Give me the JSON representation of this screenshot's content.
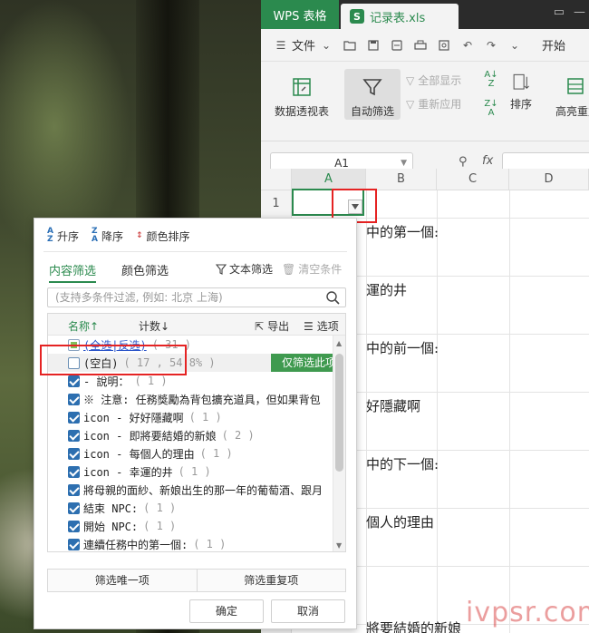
{
  "app": {
    "tab_app": "WPS 表格",
    "tab_doc": "记录表.xls",
    "tab_doc_icon": "S"
  },
  "menubar": {
    "file_label": "文件",
    "start_label": "开始"
  },
  "ribbon": {
    "pivot_label": "数据透视表",
    "autofilter_label": "自动筛选",
    "show_all_label": "全部显示",
    "reapply_label": "重新应用",
    "sort_label": "排序",
    "highlight_label": "高亮重复"
  },
  "formula": {
    "namebox": "A1",
    "fx": "fx"
  },
  "grid": {
    "columns": [
      "A",
      "B",
      "C",
      "D"
    ],
    "row1": "1",
    "cell_texts": [
      "中的第一個:",
      "運的井",
      "中的前一個:",
      "好隱藏啊",
      "中的下一個:",
      "個人的理由",
      "將要結婚的新娘"
    ]
  },
  "filter_panel": {
    "sort_asc": "升序",
    "sort_desc": "降序",
    "sort_color": "颜色排序",
    "tab_content": "内容筛选",
    "tab_color": "颜色筛选",
    "text_filter": "文本筛选",
    "clear": "清空条件",
    "search_placeholder": "(支持多条件过滤, 例如: 北京 上海)",
    "col_name": "名称↑",
    "col_count": "计数↓",
    "export": "导出",
    "options": "选项",
    "only_this": "仅筛选此项",
    "items": [
      {
        "label": "(全选|反选)",
        "count": "( 31 )",
        "state": "partial",
        "link": true
      },
      {
        "label": "(空白)",
        "count": "( 17 , 54.8% )",
        "state": "off"
      },
      {
        "label": "- 說明：",
        "count": "( 1 )",
        "state": "on"
      },
      {
        "label": "※ 注意: 任務獎勵為背包擴充道具，但如果背包",
        "count": "",
        "state": "on"
      },
      {
        "label": "icon - 好好隱藏啊",
        "count": "( 1 )",
        "state": "on"
      },
      {
        "label": "icon - 即將要結婚的新娘",
        "count": "( 2 )",
        "state": "on"
      },
      {
        "label": "icon - 每個人的理由",
        "count": "( 1 )",
        "state": "on"
      },
      {
        "label": "icon - 幸運的井",
        "count": "( 1 )",
        "state": "on"
      },
      {
        "label": "將母親的面紗、新娘出生的那一年的葡萄酒、跟月",
        "count": "",
        "state": "on"
      },
      {
        "label": "結束 NPC:",
        "count": "( 1 )",
        "state": "on"
      },
      {
        "label": "開始 NPC:",
        "count": "( 1 )",
        "state": "on"
      },
      {
        "label": "連續任務中的第一個:",
        "count": "( 1 )",
        "state": "on"
      }
    ],
    "unique_btn": "筛选唯一项",
    "dup_btn": "筛选重复项",
    "ok": "确定",
    "cancel": "取消"
  },
  "watermark": "ivpsr.com"
}
